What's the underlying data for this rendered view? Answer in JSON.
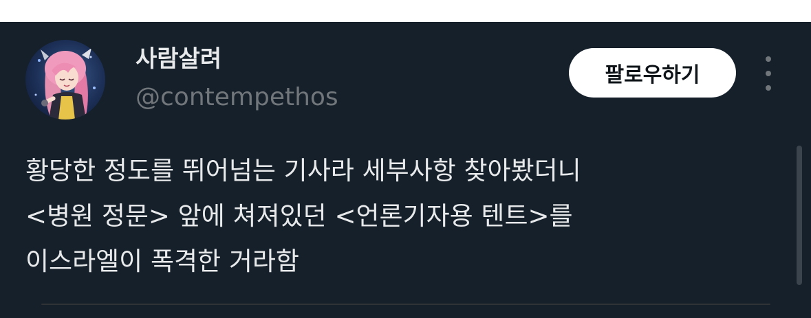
{
  "colors": {
    "background": "#15202b",
    "text_primary": "#e7e9ea",
    "text_secondary": "#71767b",
    "follow_button_bg": "#ffffff",
    "follow_button_text": "#0f1419"
  },
  "author": {
    "display_name": "사람살려",
    "handle": "@contempethos",
    "avatar_icon": "anime-character-avatar"
  },
  "header": {
    "follow_label": "팔로우하기",
    "more_icon": "more-vertical-icon"
  },
  "tweet": {
    "lines": [
      "황당한 정도를 뛰어넘는 기사라 세부사항 찾아봤더니",
      "<병원 정문> 앞에 쳐져있던 <언론기자용 텐트>를",
      "이스라엘이 폭격한 거라함"
    ]
  }
}
